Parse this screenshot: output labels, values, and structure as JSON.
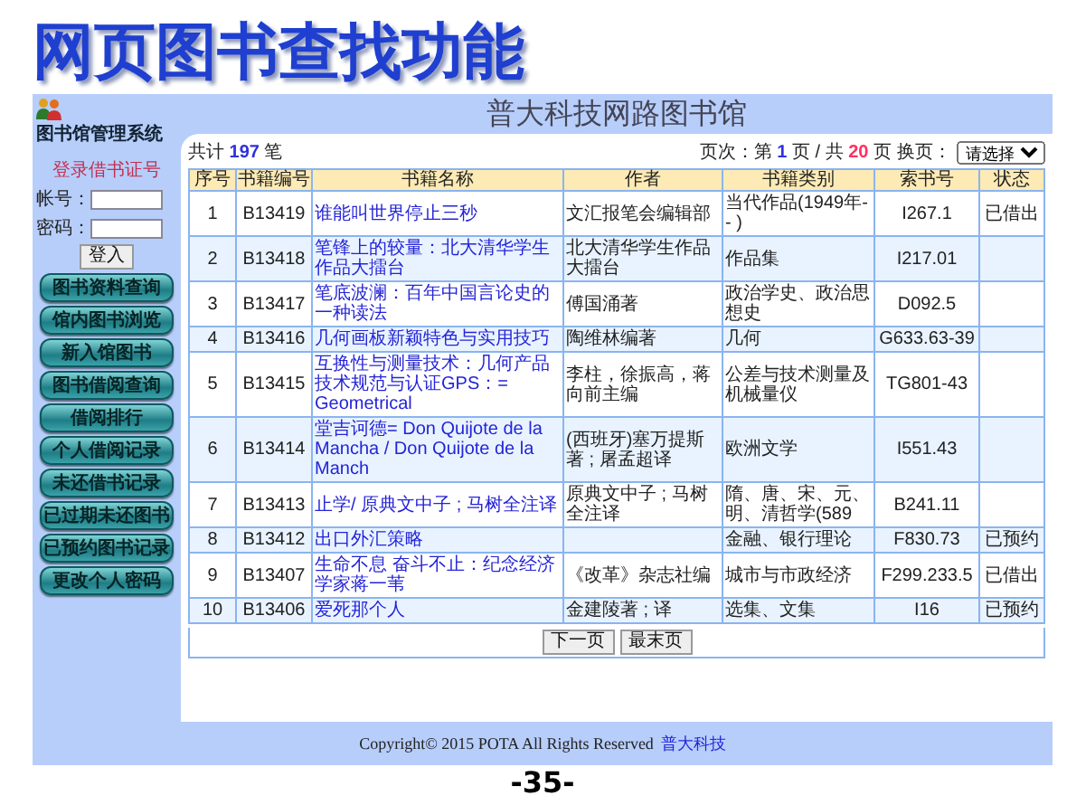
{
  "slide": {
    "title": "网页图书查找功能",
    "page_number": "-35-"
  },
  "sidebar": {
    "system_name": "图书馆管理系统",
    "login_title": "登录借书证号",
    "account_label": "帐号：",
    "password_label": "密码：",
    "login_button": "登入",
    "nav": [
      "图书资料查询",
      "馆内图书浏览",
      "新入馆图书",
      "图书借阅查询",
      "借阅排行",
      "个人借阅记录",
      "未还借书记录",
      "已过期未还图书",
      "已预约图书记录",
      "更改个人密码"
    ]
  },
  "header": {
    "site_title": "普大科技网路图书馆"
  },
  "summary": {
    "count": "共计 **197** 笔",
    "pages": "页次：第 **1** 页 / 共 **20** 页",
    "jump_label": "换页：",
    "jump_select": "请选择"
  },
  "table": {
    "columns": [
      "序号",
      "书籍编号",
      "书籍名称",
      "作者",
      "书籍类别",
      "索书号",
      "状态"
    ],
    "rows": [
      {
        "no": "1",
        "id": "B13419",
        "title": "谁能叫世界停止三秒",
        "author": "文汇报笔会编辑部",
        "category": "当代作品(1949年-- )",
        "call_number": "I267.1",
        "status": "已借出"
      },
      {
        "no": "2",
        "id": "B13418",
        "title": "笔锋上的较量：北大清华学生作品大擂台",
        "author": "北大清华学生作品大擂台",
        "category": "作品集",
        "call_number": "I217.01"
      },
      {
        "no": "3",
        "id": "B13417",
        "title": "笔底波澜：百年中国言论史的一种读法",
        "author": "傅国涌著",
        "category": "政治学史、政治思想史",
        "call_number": "D092.5"
      },
      {
        "no": "4",
        "id": "B13416",
        "title": "几何画板新颖特色与实用技巧",
        "author": "陶维林编著",
        "category": "几何",
        "call_number": "G633.63-39"
      },
      {
        "no": "5",
        "id": "B13415",
        "title": "互换性与测量技术：几何产品技术规范与认证GPS：= Geometrical",
        "author": "李柱，徐振高，蒋向前主编",
        "category": "公差与技术测量及机械量仪",
        "call_number": "TG801-43"
      },
      {
        "no": "6",
        "id": "B13414",
        "title": "堂吉诃德= Don Quijote de la Mancha / Don Quijote de la Manch",
        "author": "(西班牙)塞万提斯著 ; 屠孟超译",
        "category": "欧洲文学",
        "call_number": "I551.43"
      },
      {
        "no": "7",
        "id": "B13413",
        "title": "止学/ 原典文中子 ; 马树全注译",
        "author": "原典文中子 ; 马树全注译",
        "category": "隋、唐、宋、元、明、清哲学(589",
        "call_number": "B241.11"
      },
      {
        "no": "8",
        "id": "B13412",
        "title": "出口外汇策略",
        "category": "金融、银行理论",
        "call_number": "F830.73",
        "status": "已预约"
      },
      {
        "no": "9",
        "id": "B13407",
        "title": "生命不息 奋斗不止：纪念经济学家蒋一苇",
        "author": "《改革》杂志社编",
        "category": "城市与市政经济",
        "call_number": "F299.233.5",
        "status": "已借出"
      },
      {
        "no": "10",
        "id": "B13406",
        "title": "爱死那个人",
        "author": "金建陵著 ; 译",
        "category": "选集、文集",
        "call_number": "I16",
        "status": "已预约"
      }
    ]
  },
  "pager": [
    "下一页",
    "最末页"
  ],
  "footer": {
    "copyright": "Copyright© 2015 POTA All Rights Reserved",
    "company": "普大科技"
  }
}
